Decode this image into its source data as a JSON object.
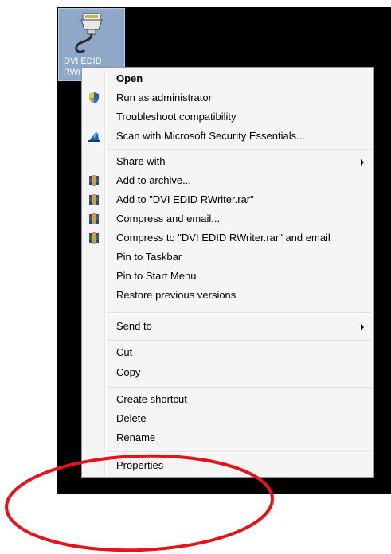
{
  "desktop_icon": {
    "name_line1": "DVI EDID",
    "name_line2": "RWri",
    "icon": "serial-cable-icon"
  },
  "context_menu": {
    "items": [
      {
        "label": "Open",
        "icon": null,
        "bold": true
      },
      {
        "label": "Run as administrator",
        "icon": "uac-shield-icon"
      },
      {
        "label": "Troubleshoot compatibility",
        "icon": null
      },
      {
        "label": "Scan with Microsoft Security Essentials...",
        "icon": "security-essentials-icon"
      },
      {
        "label": "Share with",
        "icon": null,
        "submenu": true
      },
      {
        "label": "Add to archive...",
        "icon": "winrar-icon"
      },
      {
        "label": "Add to \"DVI EDID RWriter.rar\"",
        "icon": "winrar-icon"
      },
      {
        "label": "Compress and email...",
        "icon": "winrar-icon"
      },
      {
        "label": "Compress to \"DVI EDID RWriter.rar\" and email",
        "icon": "winrar-icon"
      },
      {
        "label": "Pin to Taskbar",
        "icon": null
      },
      {
        "label": "Pin to Start Menu",
        "icon": null
      },
      {
        "label": "Restore previous versions",
        "icon": null
      },
      {
        "label": "Send to",
        "icon": null,
        "submenu": true
      },
      {
        "label": "Cut",
        "icon": null
      },
      {
        "label": "Copy",
        "icon": null
      },
      {
        "label": "Create shortcut",
        "icon": null
      },
      {
        "label": "Delete",
        "icon": null
      },
      {
        "label": "Rename",
        "icon": null
      },
      {
        "label": "Properties",
        "icon": null
      }
    ]
  },
  "annotation": {
    "color": "#e8121b"
  }
}
